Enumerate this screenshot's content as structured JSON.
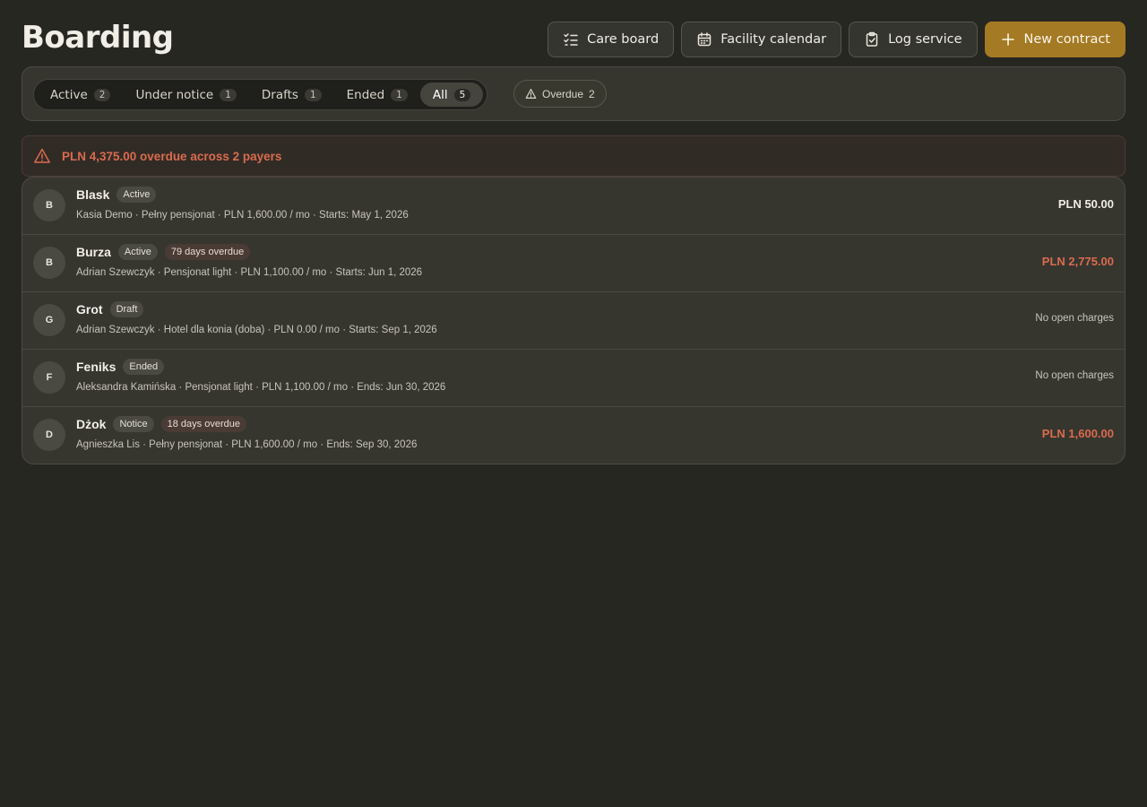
{
  "page": {
    "title": "Boarding"
  },
  "actions": {
    "care_board": {
      "label": "Care board",
      "icon": "checklist-icon"
    },
    "facility_calendar": {
      "label": "Facility calendar",
      "icon": "calendar-icon"
    },
    "log_service": {
      "label": "Log service",
      "icon": "clipboard-check-icon"
    },
    "new_contract": {
      "label": "New contract",
      "icon": "plus-icon"
    }
  },
  "filters": {
    "tabs": [
      {
        "label": "Active",
        "count": "2",
        "selected": false
      },
      {
        "label": "Under notice",
        "count": "1",
        "selected": false
      },
      {
        "label": "Drafts",
        "count": "1",
        "selected": false
      },
      {
        "label": "Ended",
        "count": "1",
        "selected": false
      },
      {
        "label": "All",
        "count": "5",
        "selected": true
      }
    ],
    "overdue": {
      "label": "Overdue",
      "count": "2",
      "icon": "warning-icon"
    }
  },
  "alert": {
    "text": "PLN 4,375.00 overdue across 2 payers",
    "icon": "warning-icon"
  },
  "contracts": [
    {
      "initial": "B",
      "name": "Blask",
      "status": "Active",
      "overdue": "",
      "meta": "Kasia Demo · Pełny pensjonat · PLN 1,600.00 / mo · Starts: May 1, 2026",
      "amount": "PLN 50.00",
      "amount_style": "normal"
    },
    {
      "initial": "B",
      "name": "Burza",
      "status": "Active",
      "overdue": "79 days overdue",
      "meta": "Adrian Szewczyk · Pensjonat light · PLN 1,100.00 / mo · Starts: Jun 1, 2026",
      "amount": "PLN 2,775.00",
      "amount_style": "red"
    },
    {
      "initial": "G",
      "name": "Grot",
      "status": "Draft",
      "overdue": "",
      "meta": "Adrian Szewczyk · Hotel dla konia (doba) · PLN 0.00 / mo · Starts: Sep 1, 2026",
      "amount": "No open charges",
      "amount_style": "none"
    },
    {
      "initial": "F",
      "name": "Feniks",
      "status": "Ended",
      "overdue": "",
      "meta": "Aleksandra Kamińska · Pensjonat light · PLN 1,100.00 / mo · Ends: Jun 30, 2026",
      "amount": "No open charges",
      "amount_style": "none"
    },
    {
      "initial": "D",
      "name": "Dżok",
      "status": "Notice",
      "overdue": "18 days overdue",
      "meta": "Agnieszka Lis · Pełny pensjonat · PLN 1,600.00 / mo · Ends: Sep 30, 2026",
      "amount": "PLN 1,600.00",
      "amount_style": "red"
    }
  ],
  "colors": {
    "background": "#272722",
    "panel": "#36362f",
    "accent": "#a47a24",
    "danger": "#d96b4e"
  }
}
